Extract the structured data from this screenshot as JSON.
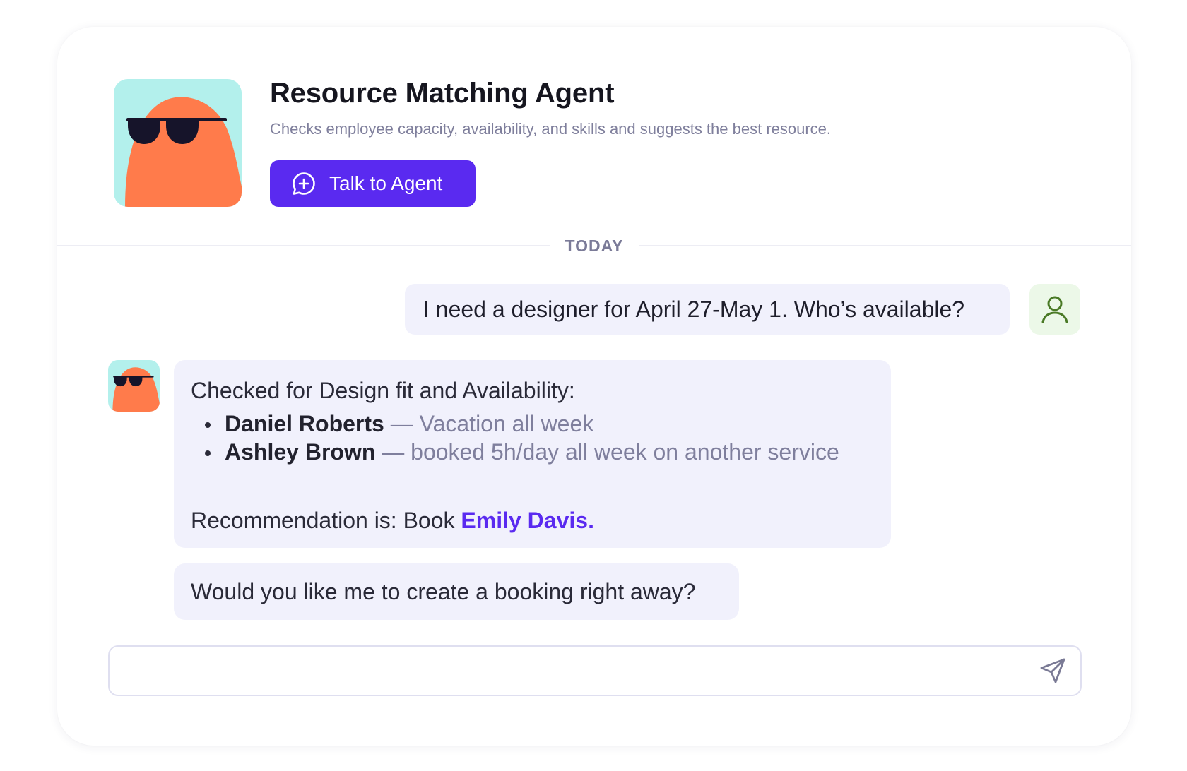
{
  "agent": {
    "name": "Resource Matching Agent",
    "description": "Checks employee capacity, availability, and skills and suggests the best resource.",
    "talk_button_label": "Talk to Agent",
    "avatar_icon": "orange-blob-sunglasses-icon"
  },
  "chat": {
    "date_label": "TODAY",
    "user_message": "I need a designer for April 27-May 1. Who’s available?",
    "user_avatar_icon": "user-icon",
    "bot_message": {
      "intro": "Checked for Design fit and Availability:",
      "items": [
        {
          "name": "Daniel Roberts",
          "note": "— Vacation all week"
        },
        {
          "name": "Ashley Brown",
          "note": "— booked 5h/day all week on another service"
        }
      ],
      "recommendation_prefix": "Recommendation is: Book ",
      "recommendation_name": "Emily Davis."
    },
    "bot_followup": "Would you like me to create a booking right away?"
  },
  "composer": {
    "value": "",
    "placeholder": "",
    "send_icon": "send-icon"
  },
  "colors": {
    "accent": "#5a2af0",
    "bubble_bg": "#f1f1fc",
    "avatar_bg": "#b3f0ec",
    "avatar_blob": "#ff7b4b",
    "user_avatar_bg": "#ecf8e8",
    "user_avatar_stroke": "#4a7a26"
  }
}
